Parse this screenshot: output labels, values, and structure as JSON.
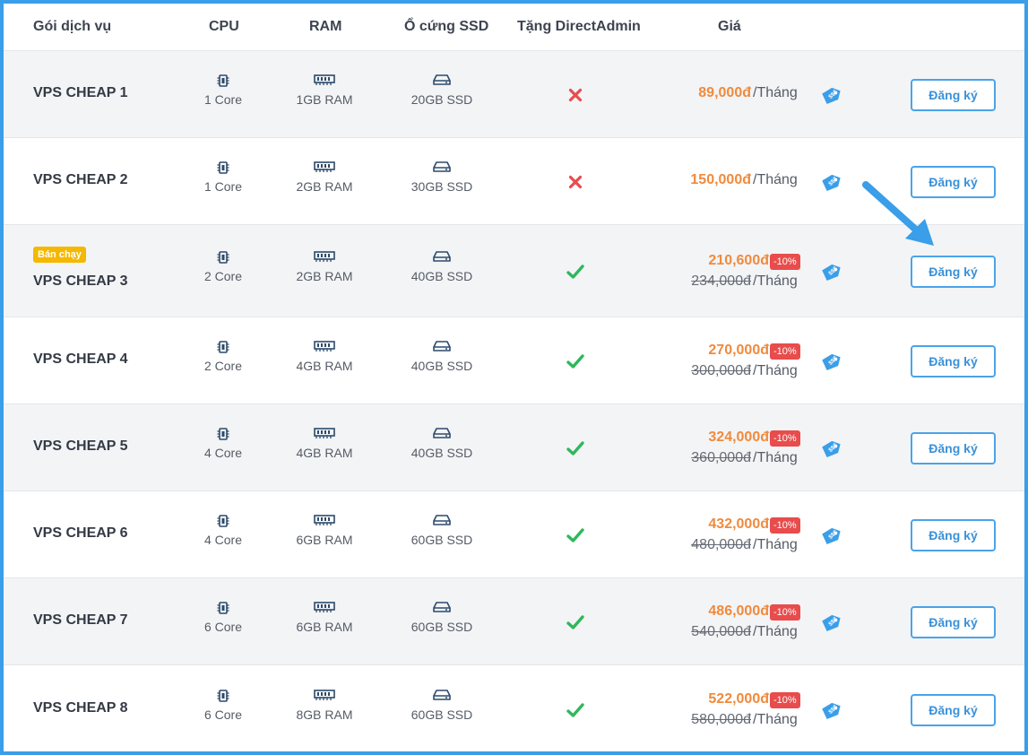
{
  "header": {
    "col_package": "Gói dịch vụ",
    "col_cpu": "CPU",
    "col_ram": "RAM",
    "col_ssd": "Ổ cứng SSD",
    "col_da": "Tặng DirectAdmin",
    "col_price": "Giá"
  },
  "colors": {
    "accent": "#3a9ee8",
    "price": "#f08a3c",
    "discount": "#e84c4c",
    "badge": "#f5b800",
    "check": "#2eb85c",
    "cross": "#e84c4c"
  },
  "icons": {
    "cpu": "cpu-chip-icon",
    "ram": "memory-icon",
    "ssd": "hard-drive-icon",
    "yes": "check-icon",
    "no": "cross-icon",
    "price_tag": "price-tag-icon",
    "pointer": "pointer-arrow-icon"
  },
  "per_month": "/Tháng",
  "register_label": "Đăng ký",
  "rows": [
    {
      "name": "VPS CHEAP 1",
      "badge": "",
      "cpu": "1 Core",
      "ram": "1GB RAM",
      "ssd": "20GB SSD",
      "directadmin": false,
      "price": "89,000đ",
      "old_price": "",
      "discount": ""
    },
    {
      "name": "VPS CHEAP 2",
      "badge": "",
      "cpu": "1 Core",
      "ram": "2GB RAM",
      "ssd": "30GB SSD",
      "directadmin": false,
      "price": "150,000đ",
      "old_price": "",
      "discount": ""
    },
    {
      "name": "VPS CHEAP 3",
      "badge": "Bán chạy",
      "cpu": "2 Core",
      "ram": "2GB RAM",
      "ssd": "40GB SSD",
      "directadmin": true,
      "price": "210,600đ",
      "old_price": "234,000đ",
      "discount": "-10%"
    },
    {
      "name": "VPS CHEAP 4",
      "badge": "",
      "cpu": "2 Core",
      "ram": "4GB RAM",
      "ssd": "40GB SSD",
      "directadmin": true,
      "price": "270,000đ",
      "old_price": "300,000đ",
      "discount": "-10%"
    },
    {
      "name": "VPS CHEAP 5",
      "badge": "",
      "cpu": "4 Core",
      "ram": "4GB RAM",
      "ssd": "40GB SSD",
      "directadmin": true,
      "price": "324,000đ",
      "old_price": "360,000đ",
      "discount": "-10%"
    },
    {
      "name": "VPS CHEAP 6",
      "badge": "",
      "cpu": "4 Core",
      "ram": "6GB RAM",
      "ssd": "60GB SSD",
      "directadmin": true,
      "price": "432,000đ",
      "old_price": "480,000đ",
      "discount": "-10%"
    },
    {
      "name": "VPS CHEAP 7",
      "badge": "",
      "cpu": "6 Core",
      "ram": "6GB RAM",
      "ssd": "60GB SSD",
      "directadmin": true,
      "price": "486,000đ",
      "old_price": "540,000đ",
      "discount": "-10%"
    },
    {
      "name": "VPS CHEAP 8",
      "badge": "",
      "cpu": "6 Core",
      "ram": "8GB RAM",
      "ssd": "60GB SSD",
      "directadmin": true,
      "price": "522,000đ",
      "old_price": "580,000đ",
      "discount": "-10%"
    }
  ]
}
